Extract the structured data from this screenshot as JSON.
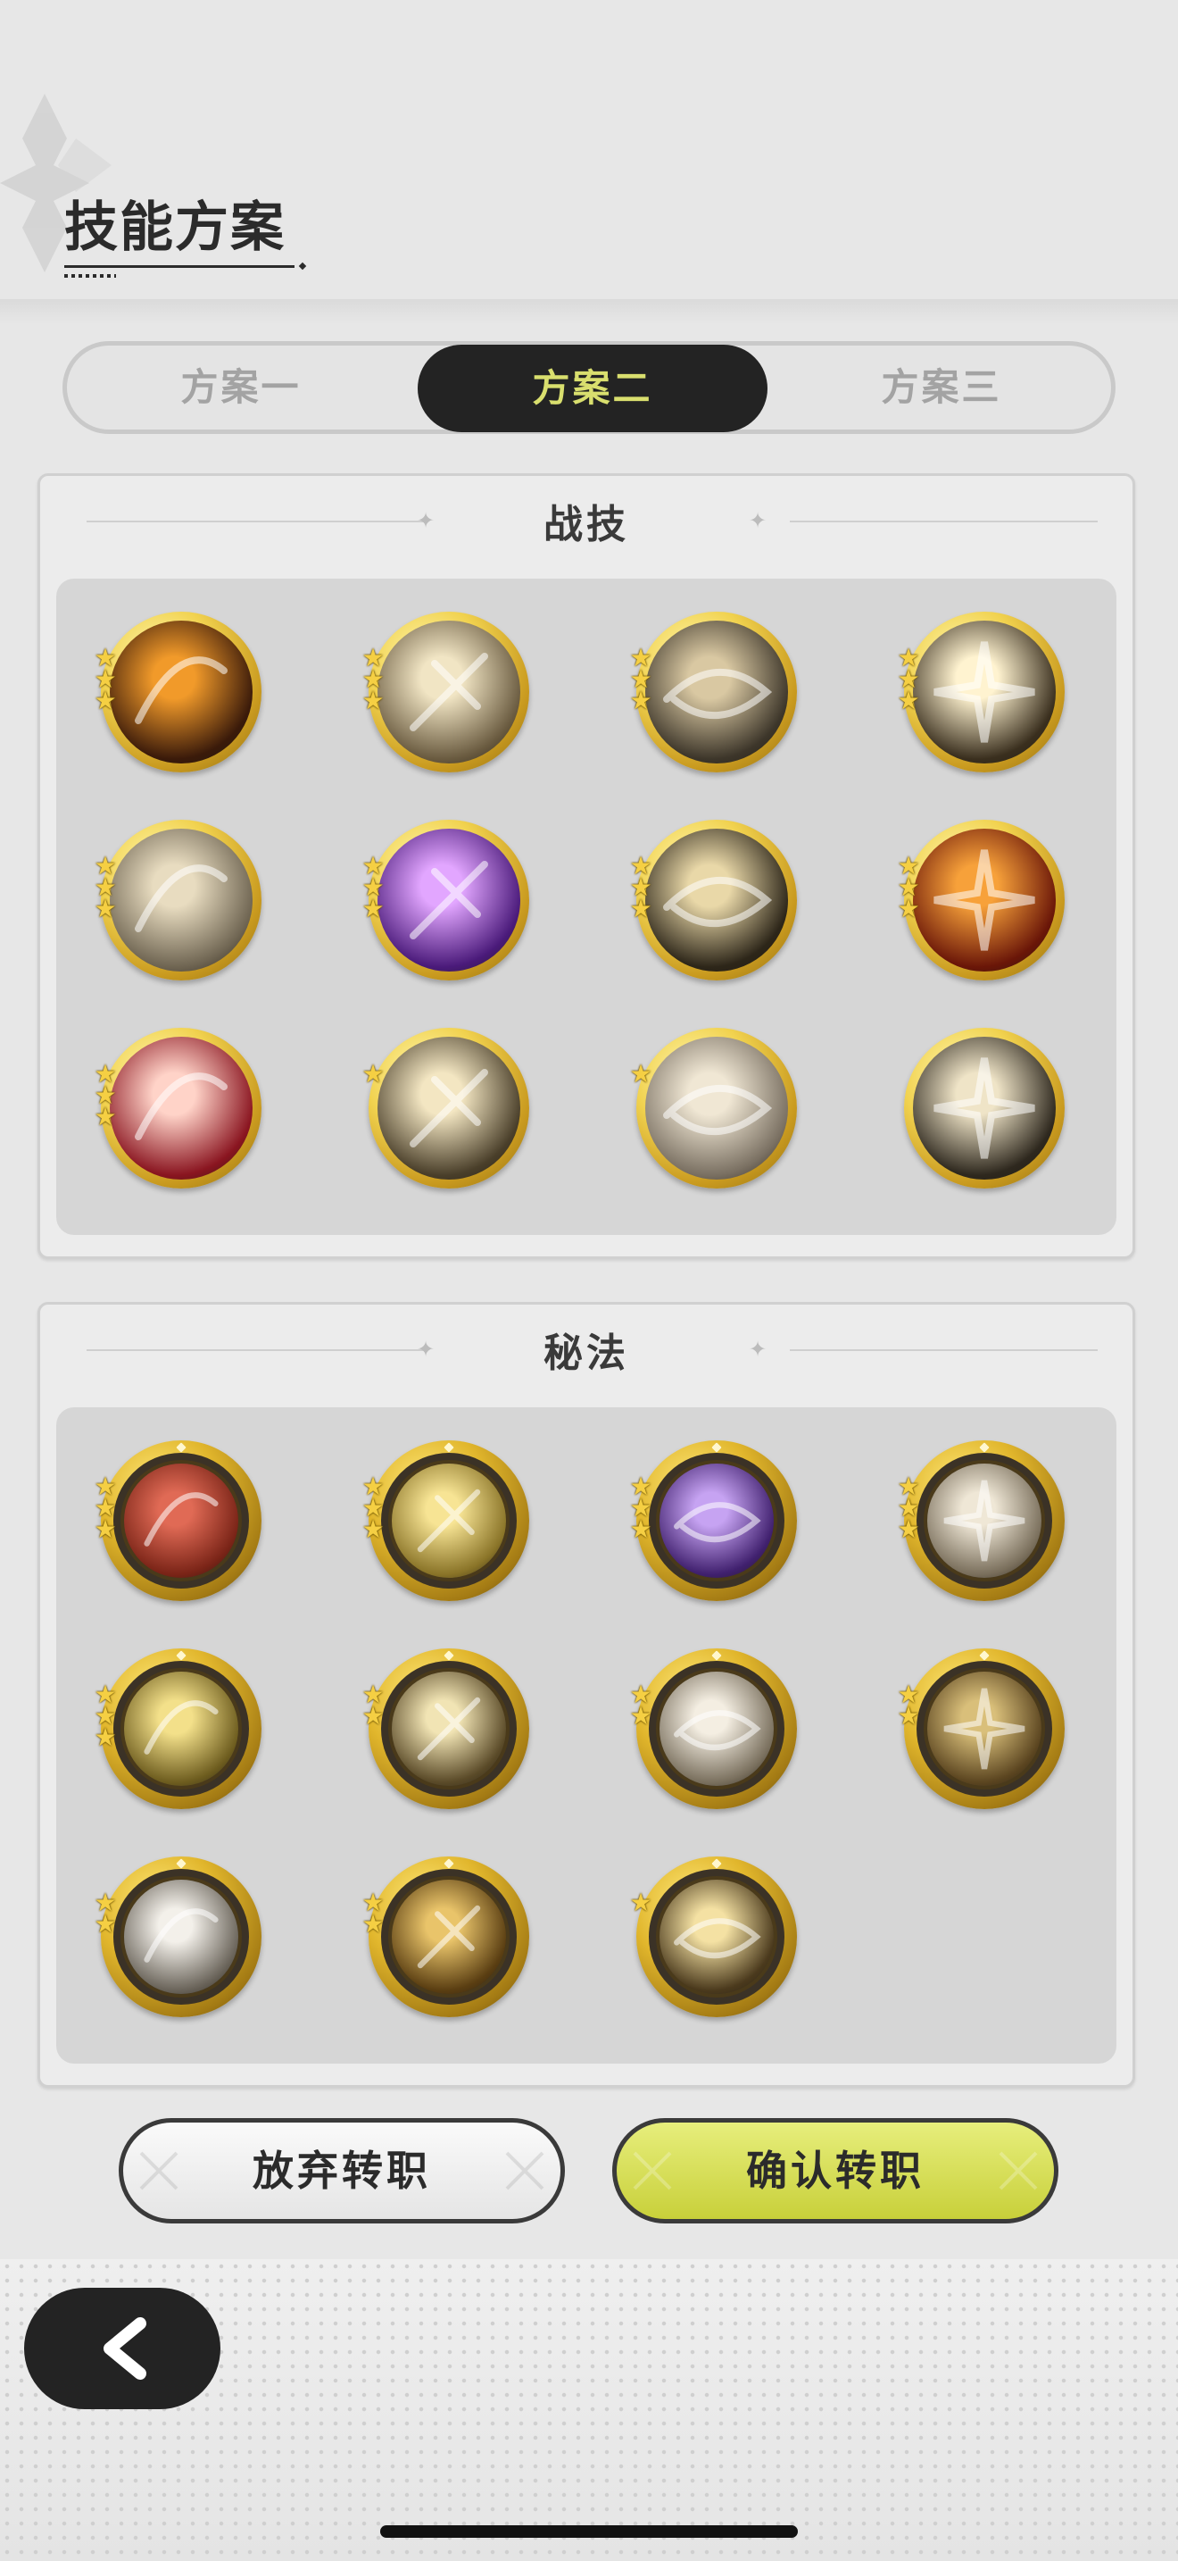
{
  "header": {
    "title": "技能方案"
  },
  "tabs": [
    {
      "label": "方案一",
      "active": false
    },
    {
      "label": "方案二",
      "active": true
    },
    {
      "label": "方案三",
      "active": false
    }
  ],
  "combat_panel": {
    "title": "战技",
    "skills": [
      {
        "icon": "flame-skill-icon",
        "stars": 3,
        "colors": [
          "#f19a2a",
          "#3a1a0a"
        ]
      },
      {
        "icon": "sword-burst-skill-icon",
        "stars": 3,
        "colors": [
          "#f1e5c4",
          "#6a5b40"
        ]
      },
      {
        "icon": "whirlwind-skill-icon",
        "stars": 3,
        "colors": [
          "#d9c8a2",
          "#3d362a"
        ]
      },
      {
        "icon": "explosion-skill-icon",
        "stars": 3,
        "colors": [
          "#fff3d0",
          "#3a2f1e"
        ]
      },
      {
        "icon": "wind-slash-skill-icon",
        "stars": 3,
        "colors": [
          "#e8dcc0",
          "#6f6552"
        ]
      },
      {
        "icon": "arcane-orb-skill-icon",
        "stars": 3,
        "colors": [
          "#e2a6ff",
          "#4a1a7a"
        ]
      },
      {
        "icon": "cross-slash-skill-icon",
        "stars": 3,
        "colors": [
          "#e9d8a8",
          "#2d2619"
        ]
      },
      {
        "icon": "fire-totem-skill-icon",
        "stars": 3,
        "colors": [
          "#f7a13a",
          "#6a1608"
        ]
      },
      {
        "icon": "rally-skill-icon",
        "stars": 3,
        "colors": [
          "#ffd3c8",
          "#8a1520"
        ]
      },
      {
        "icon": "spike-burst-skill-icon",
        "stars": 1,
        "colors": [
          "#f3e6c2",
          "#4a3f2a"
        ]
      },
      {
        "icon": "charge-skill-icon",
        "stars": 1,
        "colors": [
          "#f0e7d4",
          "#7a7062"
        ]
      },
      {
        "icon": "swift-slash-skill-icon",
        "stars": 0,
        "colors": [
          "#efe4c7",
          "#2e281e"
        ]
      }
    ]
  },
  "secret_panel": {
    "title": "秘法",
    "skills": [
      {
        "icon": "red-cloth-secret-icon",
        "stars": 3,
        "colors": [
          "#e06a55",
          "#7a2417"
        ]
      },
      {
        "icon": "shadow-figure-secret-icon",
        "stars": 3,
        "colors": [
          "#f7e494",
          "#8a7428"
        ]
      },
      {
        "icon": "raven-secret-icon",
        "stars": 3,
        "colors": [
          "#c6a3f2",
          "#40206e"
        ]
      },
      {
        "icon": "sword-upgrade-secret-icon",
        "stars": 3,
        "colors": [
          "#efe7d6",
          "#7a6f5c"
        ]
      },
      {
        "icon": "heal-shield-secret-icon",
        "stars": 3,
        "colors": [
          "#f3e08a",
          "#6e5d1f"
        ]
      },
      {
        "icon": "eye-secret-icon",
        "stars": 2,
        "colors": [
          "#f1e4b4",
          "#5a4a28"
        ]
      },
      {
        "icon": "blade-secret-icon",
        "stars": 2,
        "colors": [
          "#f4eee2",
          "#7a705e"
        ]
      },
      {
        "icon": "serpent-secret-icon",
        "stars": 2,
        "colors": [
          "#d9bf7a",
          "#5b4520"
        ]
      },
      {
        "icon": "dagger-secret-icon",
        "stars": 2,
        "colors": [
          "#f3f0ea",
          "#6a645a"
        ]
      },
      {
        "icon": "armor-secret-icon",
        "stars": 2,
        "colors": [
          "#e9c46a",
          "#5a3e12"
        ]
      },
      {
        "icon": "vortex-secret-icon",
        "stars": 1,
        "colors": [
          "#f4e1a3",
          "#4b3a1d"
        ]
      }
    ]
  },
  "actions": {
    "abandon_label": "放弃转职",
    "confirm_label": "确认转职"
  },
  "colors": {
    "background": "#e7e7e7",
    "active_tab_bg": "#232323",
    "active_tab_text": "#d9df6e",
    "confirm_button": "#d6dd50",
    "star": "#f5cf43"
  }
}
